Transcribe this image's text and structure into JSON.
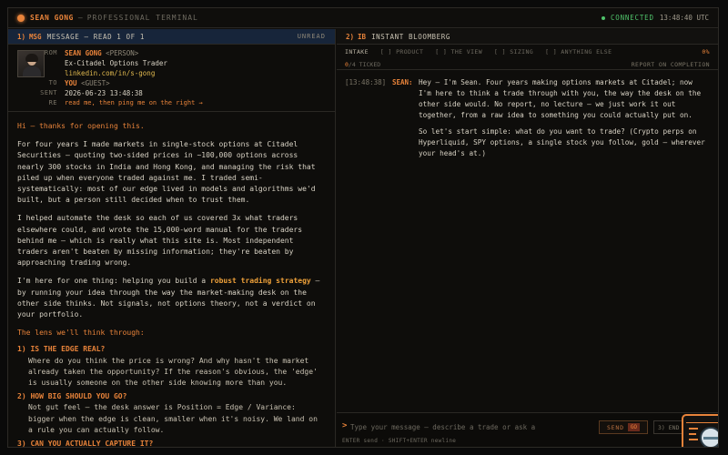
{
  "topbar": {
    "name": "SEAN GONG",
    "separator": "—",
    "subtitle": "PROFESSIONAL TERMINAL",
    "status": "CONNECTED",
    "time": "13:48:40 UTC"
  },
  "left_panel": {
    "number": "1)",
    "tag": "MSG",
    "title": "MESSAGE — READ 1 OF 1",
    "status": "UNREAD",
    "meta": {
      "from_label": "FROM",
      "from_name": "SEAN GONG",
      "from_role": "<PERSON>",
      "title_line": "Ex-Citadel Options Trader",
      "link": "linkedin.com/in/s-gong",
      "to_label": "TO",
      "to_name": "YOU",
      "to_role": "<GUEST>",
      "sent_label": "SENT",
      "sent_value": "2026-06-23 13:48:38",
      "re_label": "RE",
      "re_value": "read me, then ping me on the right →"
    },
    "body": {
      "greeting": "Hi — thanks for opening this.",
      "p1": "For four years I made markets in single-stock options at Citadel Securities — quoting two-sided prices in ~100,000 options across nearly 300 stocks in India and Hong Kong, and managing the risk that piled up when everyone traded against me. I traded semi-systematically: most of our edge lived in models and algorithms we'd built, but a person still decided when to trust them.",
      "p2": "I helped automate the desk so each of us covered 3x what traders elsewhere could, and wrote the 15,000-word manual for the traders behind me — which is really what this site is. Most independent traders aren't beaten by missing information; they're beaten by approaching trading wrong.",
      "p3_start": "I'm here for one thing: helping you build a",
      "p3_highlight": "robust trading strategy",
      "p3_end": "— by running your idea through the way the market-making desk on the other side thinks. Not signals, not options theory, not a verdict on your portfolio.",
      "lens_title": "The lens we'll think through:",
      "q1_head": "1) IS THE EDGE REAL?",
      "q1_body": "Where do you think the price is wrong? And why hasn't the market already taken the opportunity? If the reason's obvious, the 'edge' is usually someone on the other side knowing more than you.",
      "q2_head": "2) HOW BIG SHOULD YOU GO?",
      "q2_body": "Not gut feel — the desk answer is Position = Edge / Variance: bigger when the edge is clean, smaller when it's noisy. We land on a rule you can actually follow.",
      "q3_head": "3) CAN YOU ACTUALLY CAPTURE IT?"
    }
  },
  "right_panel": {
    "number": "2)",
    "tag": "IB",
    "title": "INSTANT BLOOMBERG",
    "steps": {
      "s1": "INTAKE",
      "s2": "[ ] PRODUCT",
      "s3": "[ ] THE VIEW",
      "s4": "[ ] SIZING",
      "s5": "[ ] ANYTHING ELSE",
      "percent": "0%"
    },
    "progress": {
      "count": "0",
      "total": "/4 TICKED",
      "report": "REPORT ON COMPLETION"
    },
    "chat": {
      "timestamp": "[13:48:38]",
      "speaker": "SEAN:",
      "p1": "Hey — I'm Sean. Four years making options markets at Citadel; now I'm here to think a trade through with you, the way the desk on the other side would. No report, no lecture — we just work it out together, from a raw idea to something you could actually put on.",
      "p2": "So let's start simple: what do you want to trade? (Crypto perps on Hyperliquid, SPY options, a single stock you follow, gold — wherever your head's at.)"
    },
    "composer": {
      "caret": ">",
      "placeholder": "Type your message — describe a trade or ask a",
      "send_label": "SEND",
      "send_key": "GO",
      "next_label": "3) END",
      "hint": "ENTER send · SHIFT+ENTER newline"
    }
  },
  "colors": {
    "accent": "#e8833a",
    "connected": "#4fc26a",
    "left_header_bg": "#17253a",
    "background": "#0e0d0b"
  }
}
